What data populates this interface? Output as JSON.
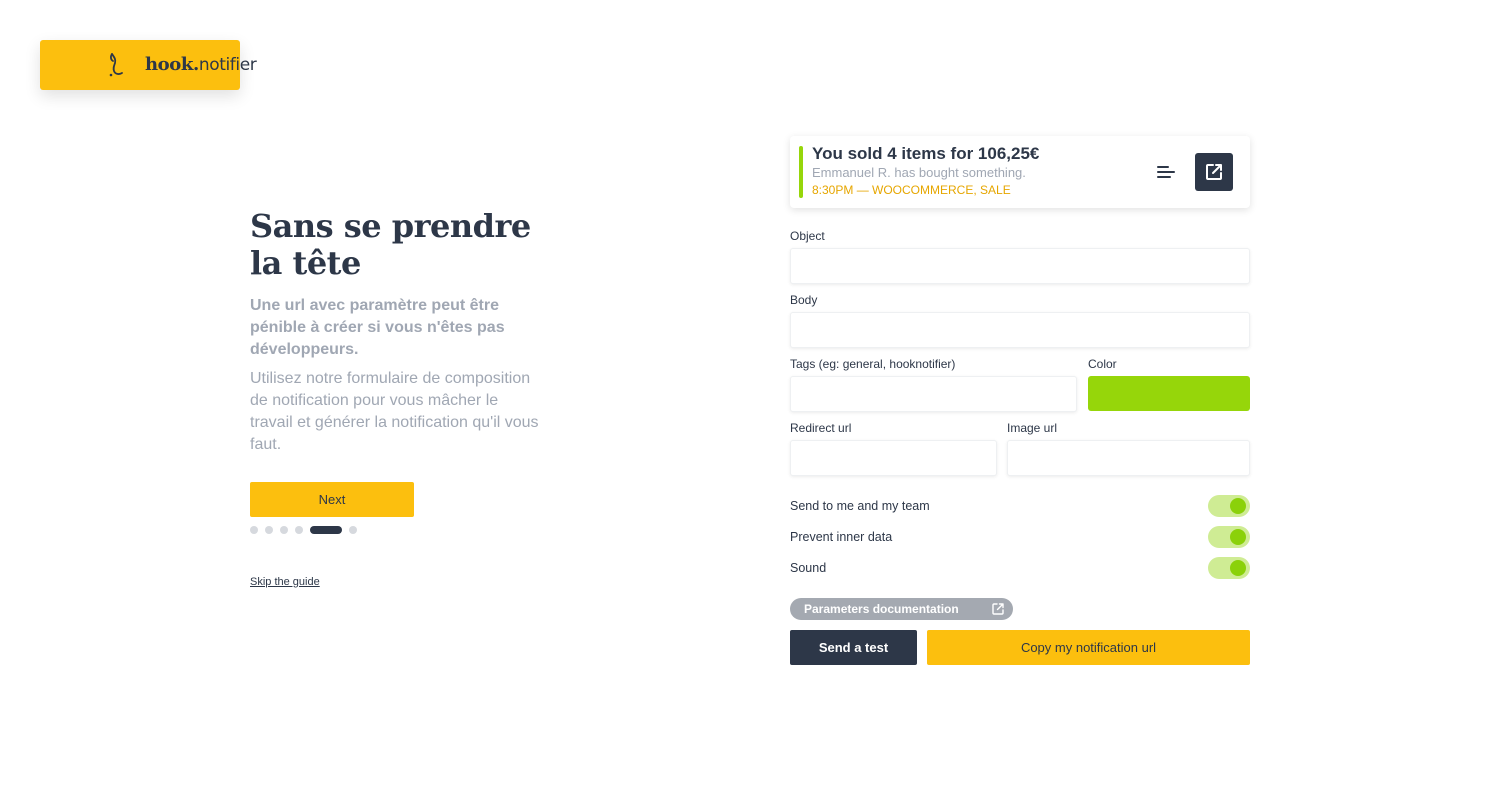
{
  "logo": {
    "brand_bold": "hook.",
    "brand_light": "notifier",
    "bg_color": "#fcbf0e"
  },
  "intro": {
    "title_line1": "Sans se prendre",
    "title_line2": "la tête",
    "lead": "Une url avec paramètre peut être pénible à créer si vous n'êtes pas développeurs.",
    "description": "Utilisez notre formulaire de composition de notification pour vous mâcher le travail et générer la notification qu'il vous faut.",
    "next_label": "Next",
    "steps_total": 6,
    "step_active": 5,
    "skip_label": "Skip the guide"
  },
  "notification_preview": {
    "title": "You sold 4 items for 106,25€",
    "subtitle": "Emmanuel R. has bought something.",
    "meta": "8:30PM — WOOCOMMERCE, SALE",
    "accent_color": "#96d60a",
    "menu_icon": "menu-lines-icon",
    "open_icon": "external-link-icon"
  },
  "form": {
    "object_label": "Object",
    "object_value": "",
    "body_label": "Body",
    "body_value": "",
    "tags_label": "Tags (eg: general, hooknotifier)",
    "tags_value": "",
    "color_label": "Color",
    "color_value": "#96d60a",
    "redirect_label": "Redirect url",
    "redirect_value": "",
    "image_label": "Image url",
    "image_value": ""
  },
  "toggles": [
    {
      "label": "Send to me and my team",
      "on": true
    },
    {
      "label": "Prevent inner data",
      "on": true
    },
    {
      "label": "Sound",
      "on": true
    }
  ],
  "actions": {
    "docs_label": "Parameters documentation",
    "send_test_label": "Send a test",
    "copy_url_label": "Copy my notification url"
  }
}
